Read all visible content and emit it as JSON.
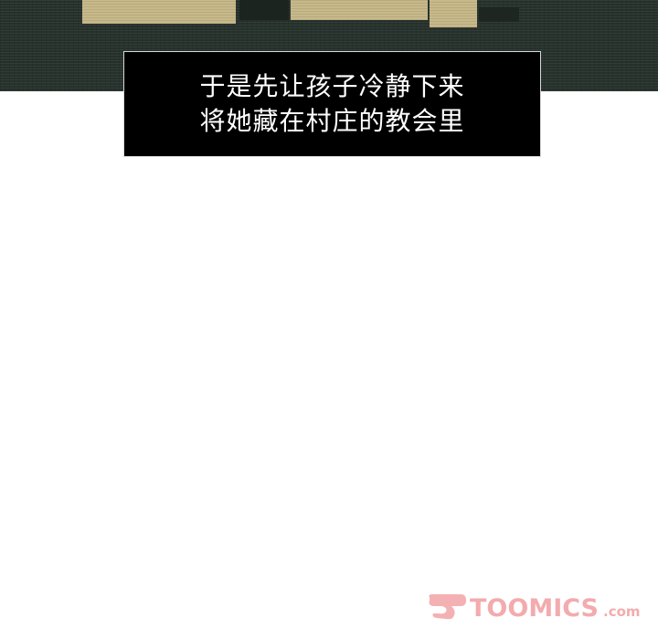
{
  "caption": {
    "lines": [
      "于是先让孩子冷静下来",
      "将她藏在村庄的教会里"
    ]
  },
  "watermark": {
    "text": "TOOMICS.com",
    "main_text": "TOOMICS",
    "suffix_text": ".com",
    "color": "#f2a3a6"
  },
  "panel": {
    "background_color": "#26312c",
    "accent_color": "#c8b98a"
  }
}
